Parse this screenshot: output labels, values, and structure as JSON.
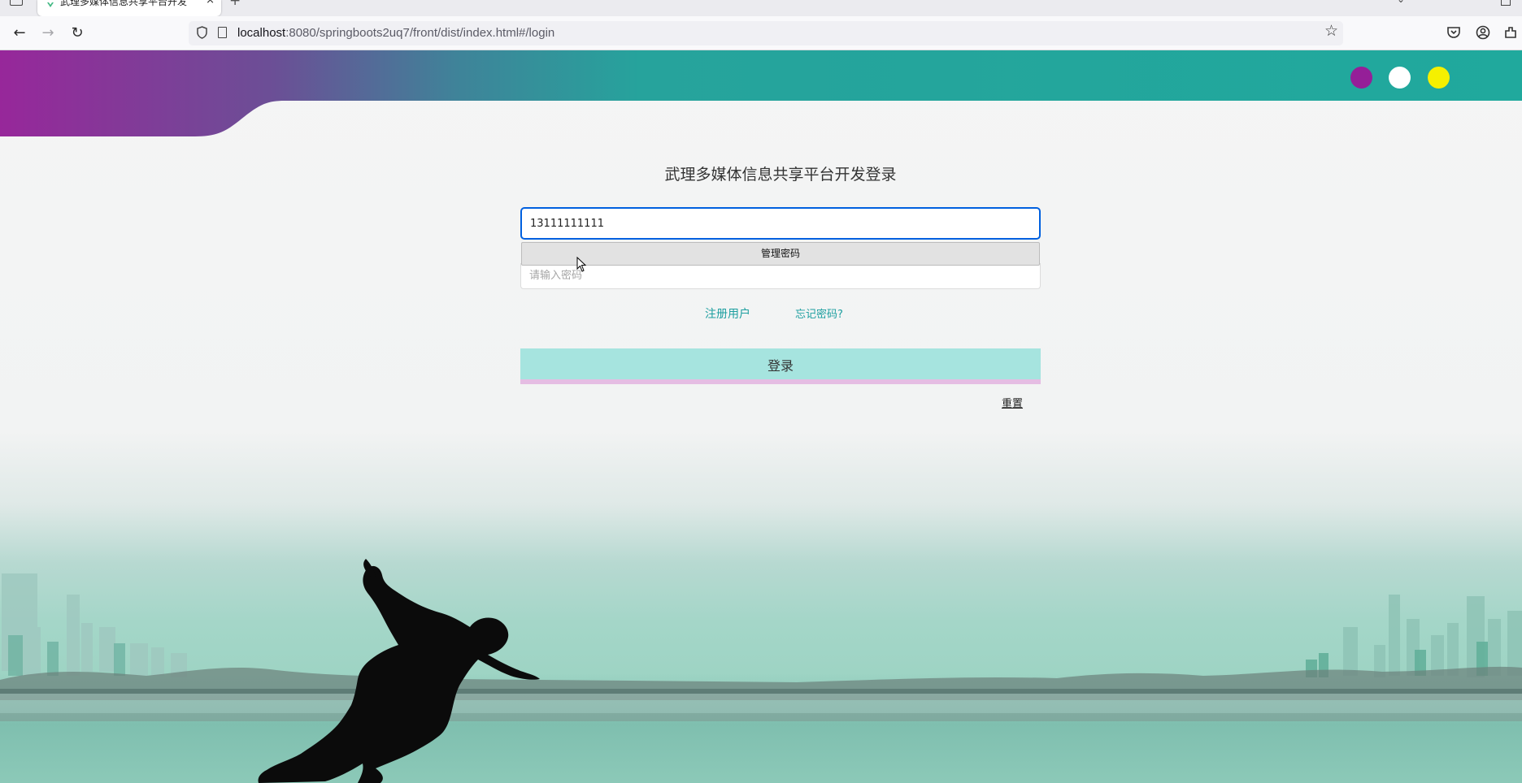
{
  "browser": {
    "tab_title": "武理多媒体信息共享平台开发",
    "url_host": "localhost",
    "url_rest": ":8080/springboots2uq7/front/dist/index.html#/login",
    "tab_close": "×",
    "new_tab": "+"
  },
  "header": {
    "dot_colors": [
      "#951f98",
      "#ffffff",
      "#f5f000"
    ]
  },
  "login": {
    "title": "武理多媒体信息共享平台开发登录",
    "username_value": "13111111111",
    "autofill_label": "管理密码",
    "password_placeholder": "请输入密码",
    "register_link": "注册用户",
    "forgot_link": "忘记密码?",
    "submit_label": "登录",
    "reset_label": "重置"
  },
  "colors": {
    "header_gradient_start": "#97279a",
    "header_gradient_end": "#20a99d",
    "login_button_bg": "#a6e4df",
    "login_button_stripe": "#e5bde3",
    "link_color": "#1d9fa0",
    "focus_border": "#0060df"
  },
  "icons": {
    "back": "back-arrow-icon",
    "forward": "forward-arrow-icon",
    "reload": "reload-icon",
    "bookmark": "star-icon",
    "pocket": "pocket-icon",
    "account": "account-icon",
    "extensions": "extensions-icon"
  }
}
